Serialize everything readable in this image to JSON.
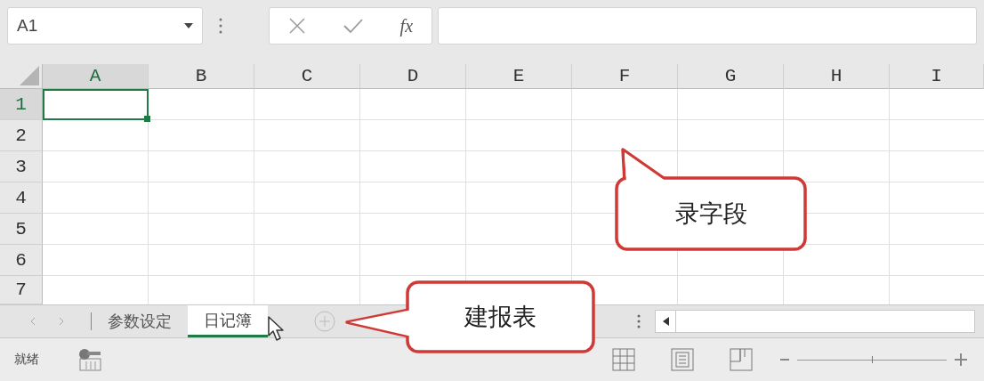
{
  "formula_bar": {
    "name_box": "A1",
    "function_label": "fx"
  },
  "sheet": {
    "columns": [
      {
        "label": "A",
        "selected": true
      },
      {
        "label": "B",
        "selected": false
      },
      {
        "label": "C",
        "selected": false
      },
      {
        "label": "D",
        "selected": false
      },
      {
        "label": "E",
        "selected": false
      },
      {
        "label": "F",
        "selected": false
      },
      {
        "label": "G",
        "selected": false
      },
      {
        "label": "H",
        "selected": false
      },
      {
        "label": "I",
        "selected": false
      }
    ],
    "rows": [
      {
        "label": "1",
        "selected": true
      },
      {
        "label": "2",
        "selected": false
      },
      {
        "label": "3",
        "selected": false
      },
      {
        "label": "4",
        "selected": false
      },
      {
        "label": "5",
        "selected": false
      },
      {
        "label": "6",
        "selected": false
      },
      {
        "label": "7",
        "selected": false
      }
    ]
  },
  "sheet_tabs": [
    {
      "label": "参数设定",
      "selected": false
    },
    {
      "label": "日记簿",
      "selected": true
    }
  ],
  "status_bar": {
    "status": "就绪",
    "zoom": {
      "level": 0.5
    }
  },
  "callouts": [
    {
      "text": "录字段"
    },
    {
      "text": "建报表"
    }
  ]
}
